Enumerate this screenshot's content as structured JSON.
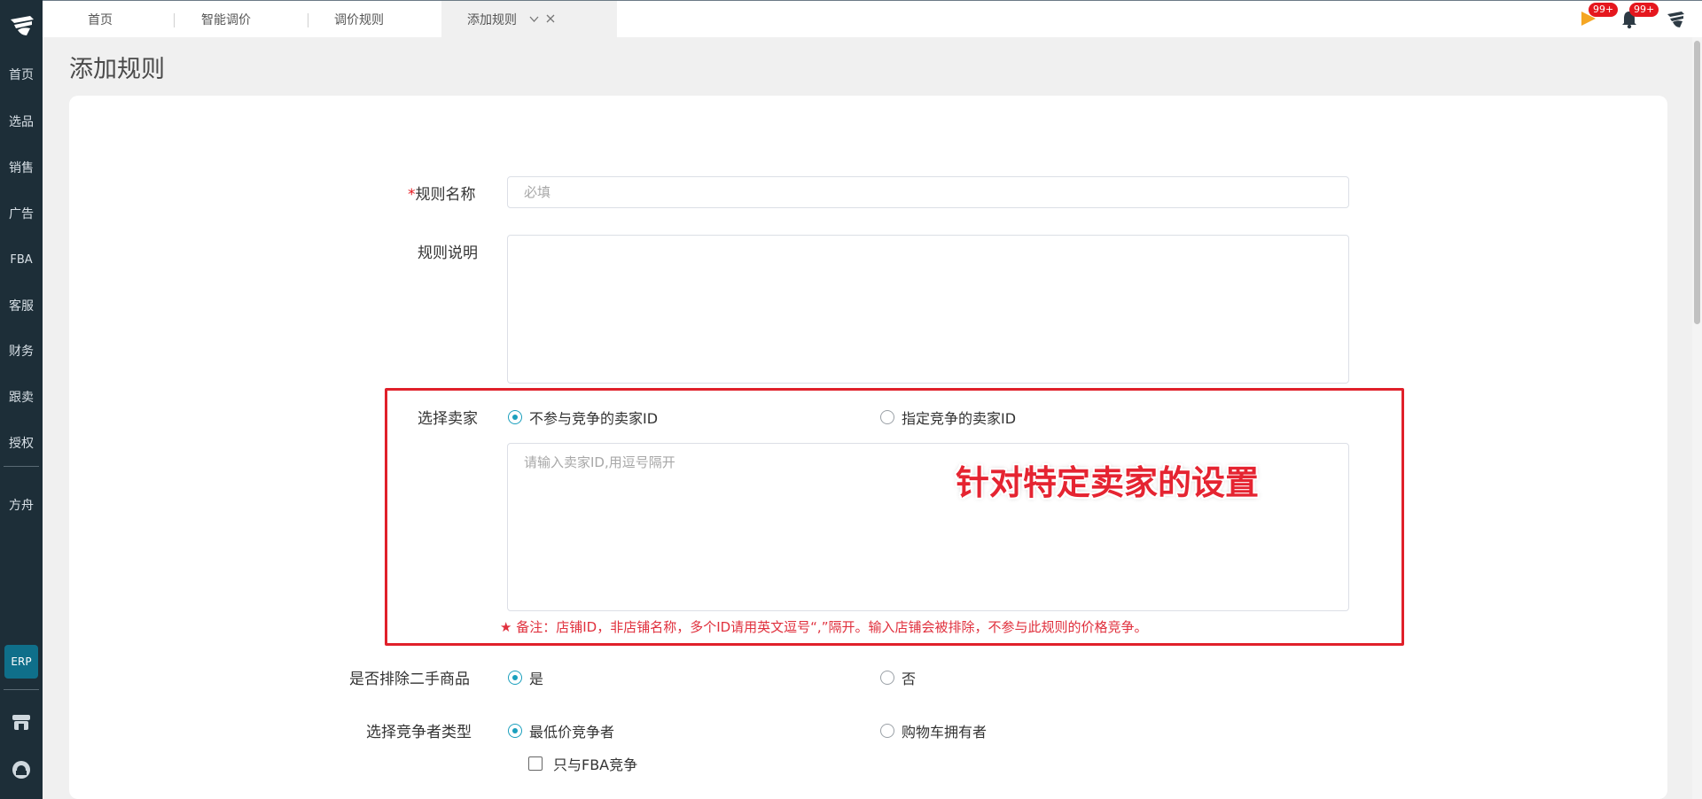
{
  "sidebar": {
    "items": [
      {
        "label": "首页"
      },
      {
        "label": "选品"
      },
      {
        "label": "销售"
      },
      {
        "label": "广告"
      },
      {
        "label": "FBA"
      },
      {
        "label": "客服"
      },
      {
        "label": "财务"
      },
      {
        "label": "跟卖"
      },
      {
        "label": "授权"
      },
      {
        "label": "方舟"
      }
    ],
    "erp_label": "ERP"
  },
  "tabs": [
    {
      "label": "首页"
    },
    {
      "label": "智能调价"
    },
    {
      "label": "调价规则"
    },
    {
      "label": "添加规则",
      "active": true
    }
  ],
  "header": {
    "flag_badge": "99+",
    "bell_badge": "99+"
  },
  "page": {
    "title": "添加规则"
  },
  "form": {
    "rule_name": {
      "required_mark": "*",
      "label": "规则名称",
      "placeholder": "必填",
      "value": ""
    },
    "rule_desc": {
      "label": "规则说明",
      "value": ""
    },
    "seller": {
      "label": "选择卖家",
      "options": [
        {
          "label": "不参与竞争的卖家ID",
          "checked": true
        },
        {
          "label": "指定竞争的卖家ID",
          "checked": false
        }
      ],
      "placeholder": "请输入卖家ID,用逗号隔开",
      "note": "★ 备注：店铺ID，非店铺名称，多个ID请用英文逗号“,”隔开。输入店铺会被排除，不参与此规则的价格竞争。"
    },
    "exclude_used": {
      "label": "是否排除二手商品",
      "options": [
        {
          "label": "是",
          "checked": true
        },
        {
          "label": "否",
          "checked": false
        }
      ]
    },
    "competitor_type": {
      "label": "选择竞争者类型",
      "options": [
        {
          "label": "最低价竞争者",
          "checked": true
        },
        {
          "label": "购物车拥有者",
          "checked": false
        }
      ],
      "fba_only": {
        "label": "只与FBA竞争",
        "checked": false
      }
    }
  },
  "annotation": {
    "text": "针对特定卖家的设置"
  },
  "colors": {
    "sidebar_bg": "#1d2e38",
    "accent": "#1a9fbd",
    "annotation": "#e52431",
    "badge": "#e5171e"
  }
}
